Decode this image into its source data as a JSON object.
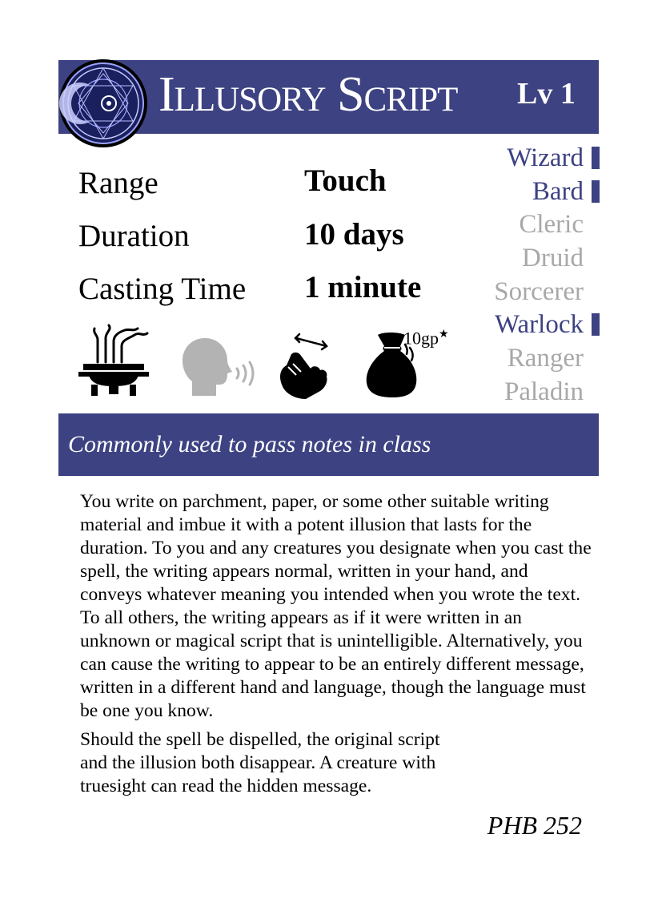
{
  "spell": {
    "name": "Illusory Script",
    "level": "Lv 1",
    "subtitle": "Commonly used to pass notes in class",
    "source": "PHB 252"
  },
  "stats": [
    {
      "label": "Range",
      "value": "Touch"
    },
    {
      "label": "Duration",
      "value": "10 days"
    },
    {
      "label": "Casting Time",
      "value": "1 minute"
    }
  ],
  "classes": [
    {
      "name": "Wizard",
      "active": true
    },
    {
      "name": "Bard",
      "active": true
    },
    {
      "name": "Cleric",
      "active": false
    },
    {
      "name": "Druid",
      "active": false
    },
    {
      "name": "Sorcerer",
      "active": false
    },
    {
      "name": "Warlock",
      "active": true
    },
    {
      "name": "Ranger",
      "active": false
    },
    {
      "name": "Paladin",
      "active": false
    }
  ],
  "components": {
    "ritual_icon": "incense-burner-icon",
    "verbal_icon": "speaking-head-icon",
    "somatic_icon": "hand-gesture-icon",
    "material_icon": "coin-pouch-icon",
    "material_cost": "10gp",
    "material_cost_mark": "★"
  },
  "description": [
    "You write on parchment, paper, or some other suitable writing material and imbue it with a potent illusion that lasts for the duration. To you and any creatures you designate when you cast the spell, the writing appears normal, written in your hand, and conveys whatever meaning you intended when you wrote the text. To all others, the writing appears as if it were written in an unknown or magical script that is unintelligible. Alternatively, you can cause the writing to appear to be an entirely different message, written in a different hand and language, though the language must be one you know.",
    "Should the spell be dispelled, the original script and the illusion both disappear. A creature with truesight can read the hidden message."
  ],
  "colors": {
    "accent": "#3d4282",
    "inactive_class": "#a8a8a8",
    "verbal_disabled": "#b3b3b3"
  }
}
